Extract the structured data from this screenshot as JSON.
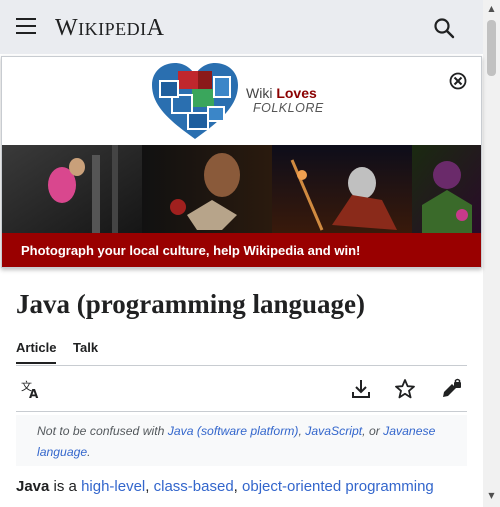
{
  "header": {
    "wordmark": "Wikipedia",
    "menu_icon": "hamburger-menu-icon",
    "search_icon": "search-icon",
    "bg_color": "#eaecf0"
  },
  "banner": {
    "logo_line1_prefix": "Wiki ",
    "logo_line1_emph": "Loves",
    "logo_line2": "FOLKLORE",
    "close_icon": "close-circle-icon",
    "cta": "Photograph your local culture, help Wikipedia and win!",
    "cta_color": "#990000"
  },
  "article": {
    "title": "Java (programming language)",
    "tabs": [
      {
        "label": "Article"
      },
      {
        "label": "Talk"
      }
    ],
    "tools": [
      "language-icon",
      "download-icon",
      "star-icon",
      "edit-lock-icon"
    ],
    "hatnote": {
      "prefix": "Not to be confused with ",
      "link1": "Java (software platform)",
      "sep1": ", ",
      "link2": "JavaScript",
      "sep2": ", or ",
      "link3": "Javanese language",
      "suffix": "."
    },
    "lead": {
      "bold": "Java",
      "text1": " is a ",
      "link1": "high-level",
      "sep1": ", ",
      "link2": "class-based",
      "sep2": ", ",
      "link3": "object-oriented programming"
    }
  },
  "colors": {
    "link": "#3366cc",
    "text": "#202122",
    "border": "#c8ccd1"
  }
}
